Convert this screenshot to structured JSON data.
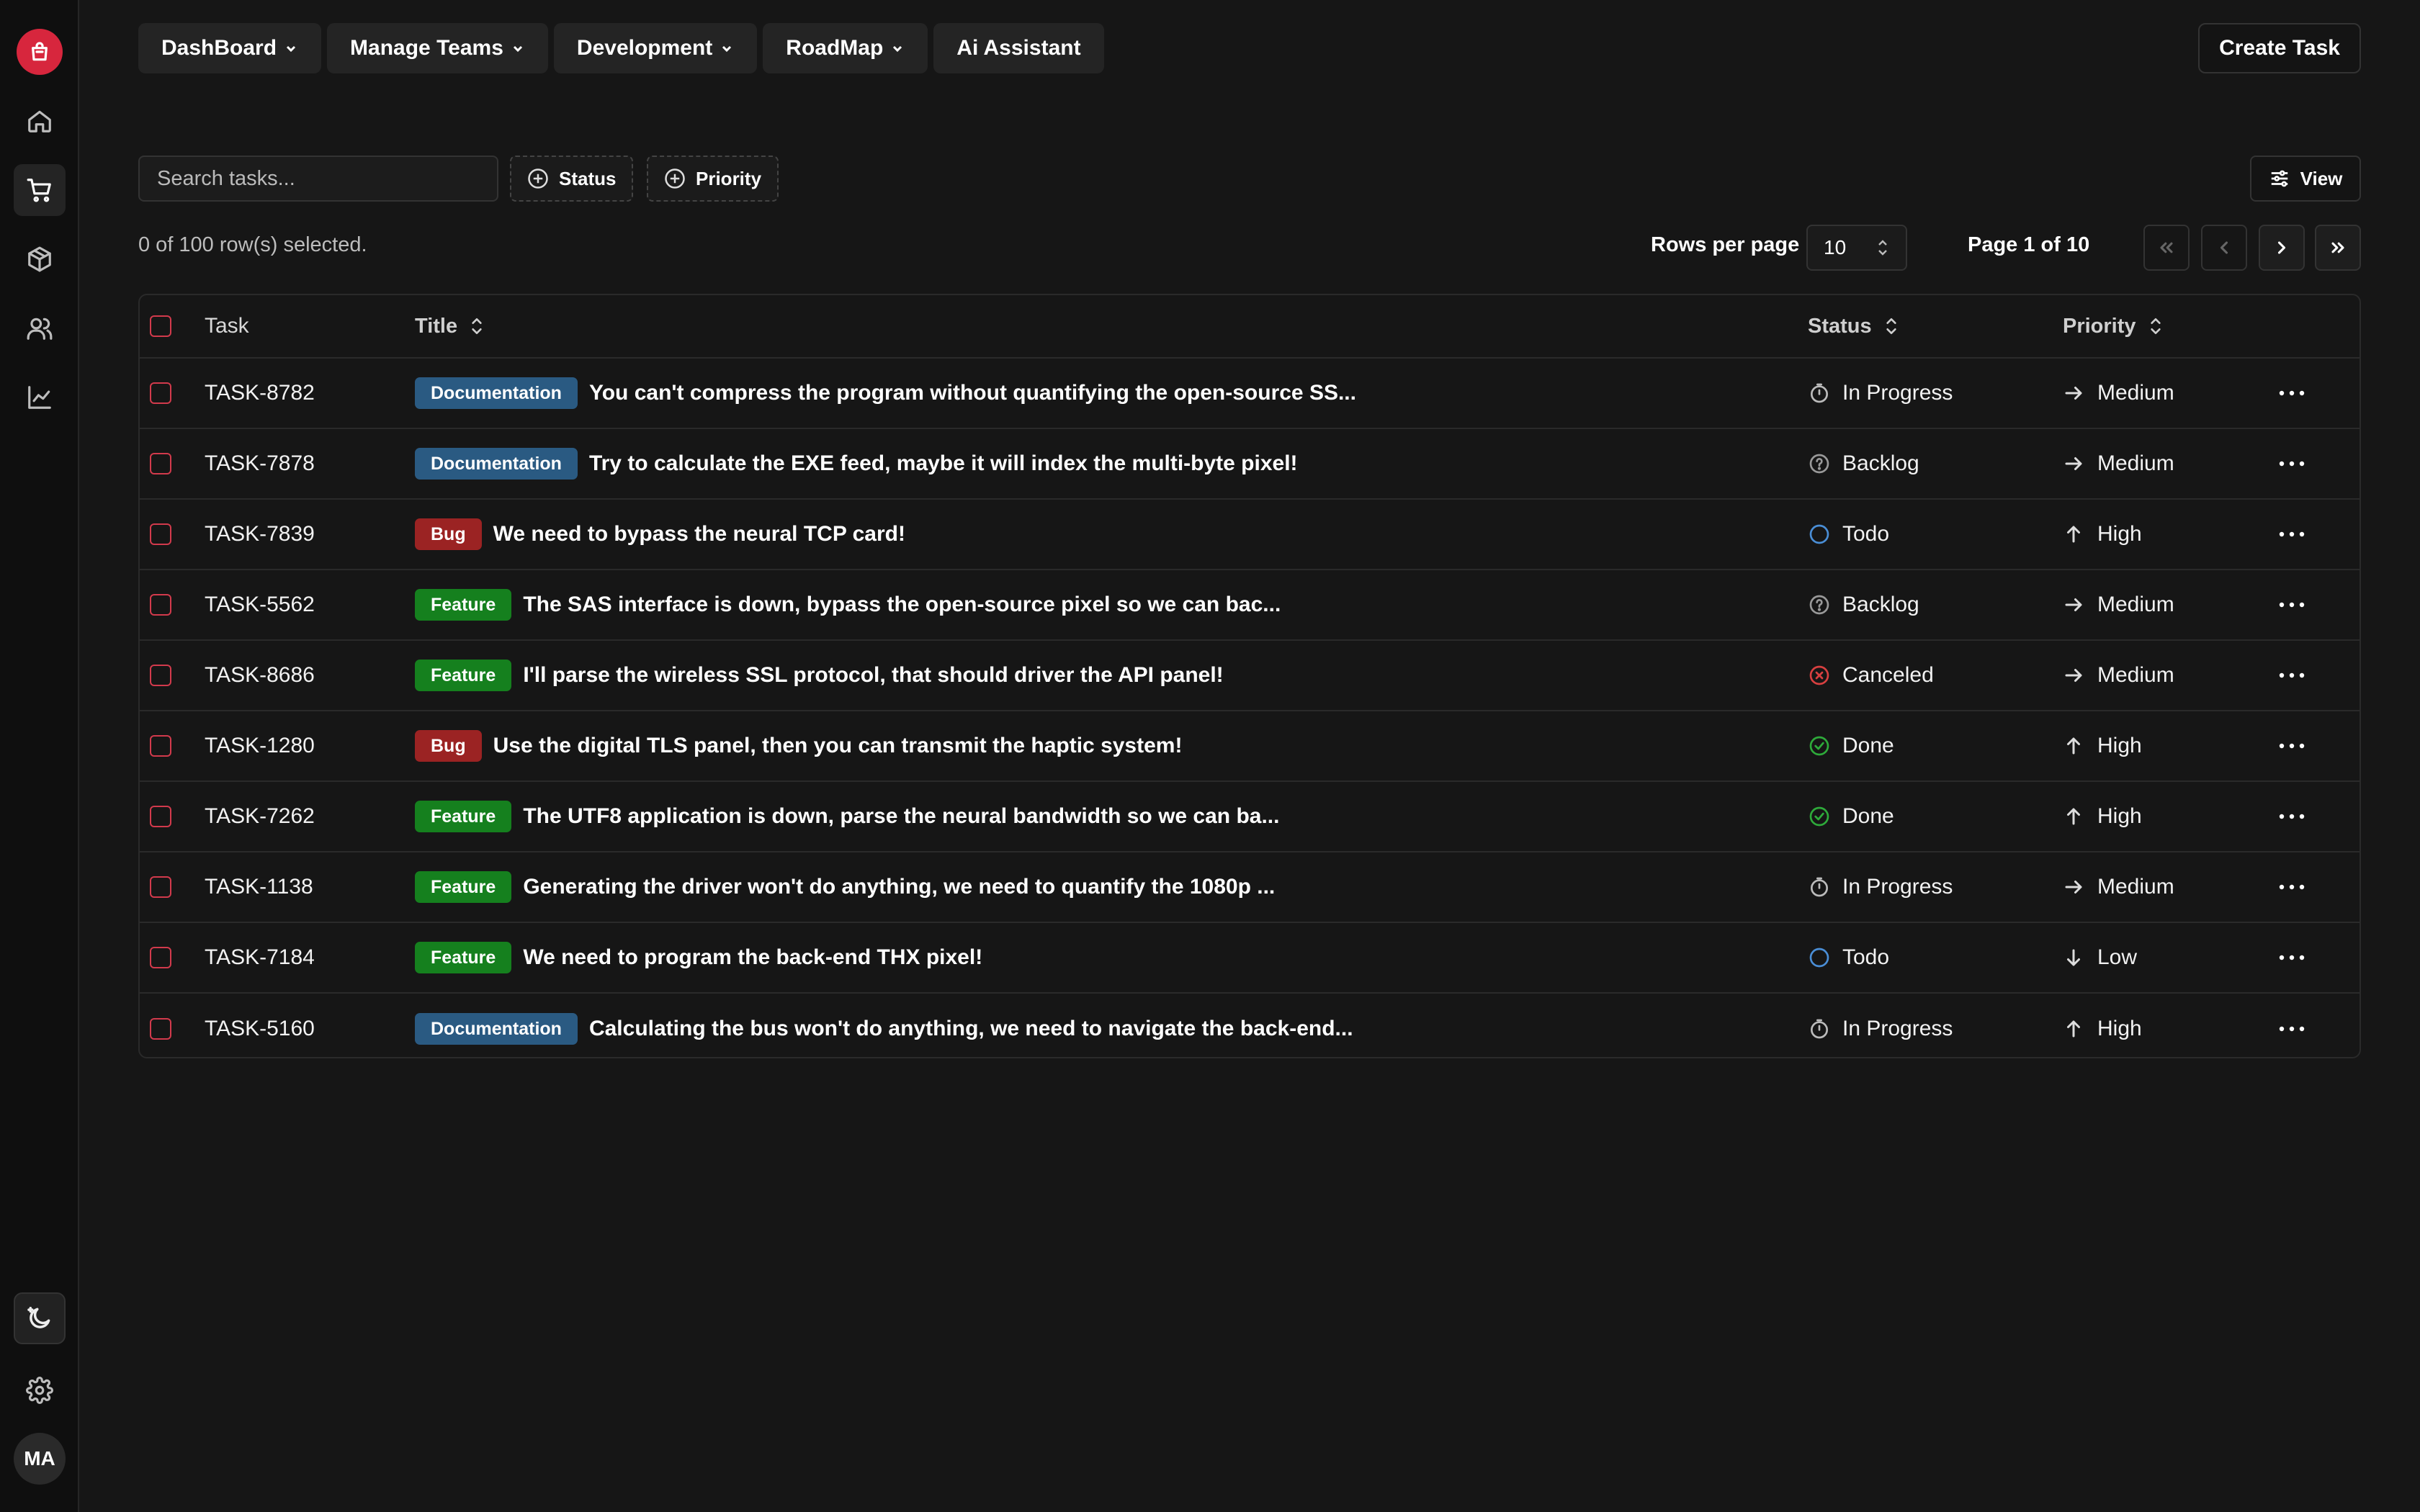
{
  "nav": {
    "items": [
      {
        "label": "DashBoard",
        "dropdown": true
      },
      {
        "label": "Manage Teams",
        "dropdown": true
      },
      {
        "label": "Development",
        "dropdown": true
      },
      {
        "label": "RoadMap",
        "dropdown": true
      },
      {
        "label": "Ai Assistant",
        "dropdown": false
      }
    ],
    "create_label": "Create Task"
  },
  "sidebar": {
    "logo_icon": "shopping-bag-icon",
    "items": [
      "home-icon",
      "cart-icon",
      "package-icon",
      "users-icon",
      "chart-icon"
    ],
    "active_item": "cart-icon",
    "bottom": [
      "theme-toggle-icon",
      "gear-icon"
    ],
    "avatar_initials": "MA"
  },
  "toolbar": {
    "search_placeholder": "Search tasks...",
    "status_filter": "Status",
    "priority_filter": "Priority",
    "view_label": "View"
  },
  "pagination": {
    "selected_text": "0 of 100 row(s) selected.",
    "rows_label": "Rows per page",
    "rows_value": "10",
    "page_text": "Page 1 of 10"
  },
  "table": {
    "headers": {
      "task": "Task",
      "title": "Title",
      "status": "Status",
      "priority": "Priority"
    },
    "rows": [
      {
        "id": "TASK-8782",
        "label": "Documentation",
        "title": "You can't compress the program without quantifying the open-source SS...",
        "status": "In Progress",
        "priority": "Medium"
      },
      {
        "id": "TASK-7878",
        "label": "Documentation",
        "title": "Try to calculate the EXE feed, maybe it will index the multi-byte pixel!",
        "status": "Backlog",
        "priority": "Medium"
      },
      {
        "id": "TASK-7839",
        "label": "Bug",
        "title": "We need to bypass the neural TCP card!",
        "status": "Todo",
        "priority": "High"
      },
      {
        "id": "TASK-5562",
        "label": "Feature",
        "title": "The SAS interface is down, bypass the open-source pixel so we can bac...",
        "status": "Backlog",
        "priority": "Medium"
      },
      {
        "id": "TASK-8686",
        "label": "Feature",
        "title": "I'll parse the wireless SSL protocol, that should driver the API panel!",
        "status": "Canceled",
        "priority": "Medium"
      },
      {
        "id": "TASK-1280",
        "label": "Bug",
        "title": "Use the digital TLS panel, then you can transmit the haptic system!",
        "status": "Done",
        "priority": "High"
      },
      {
        "id": "TASK-7262",
        "label": "Feature",
        "title": "The UTF8 application is down, parse the neural bandwidth so we can ba...",
        "status": "Done",
        "priority": "High"
      },
      {
        "id": "TASK-1138",
        "label": "Feature",
        "title": "Generating the driver won't do anything, we need to quantify the 1080p ...",
        "status": "In Progress",
        "priority": "Medium"
      },
      {
        "id": "TASK-7184",
        "label": "Feature",
        "title": "We need to program the back-end THX pixel!",
        "status": "Todo",
        "priority": "Low"
      },
      {
        "id": "TASK-5160",
        "label": "Documentation",
        "title": "Calculating the bus won't do anything, we need to navigate the back-end...",
        "status": "In Progress",
        "priority": "High"
      }
    ]
  },
  "colors": {
    "Documentation": "#2a5a82",
    "Bug": "#9b2323",
    "Feature": "#15801e",
    "accent": "#d7263d"
  }
}
